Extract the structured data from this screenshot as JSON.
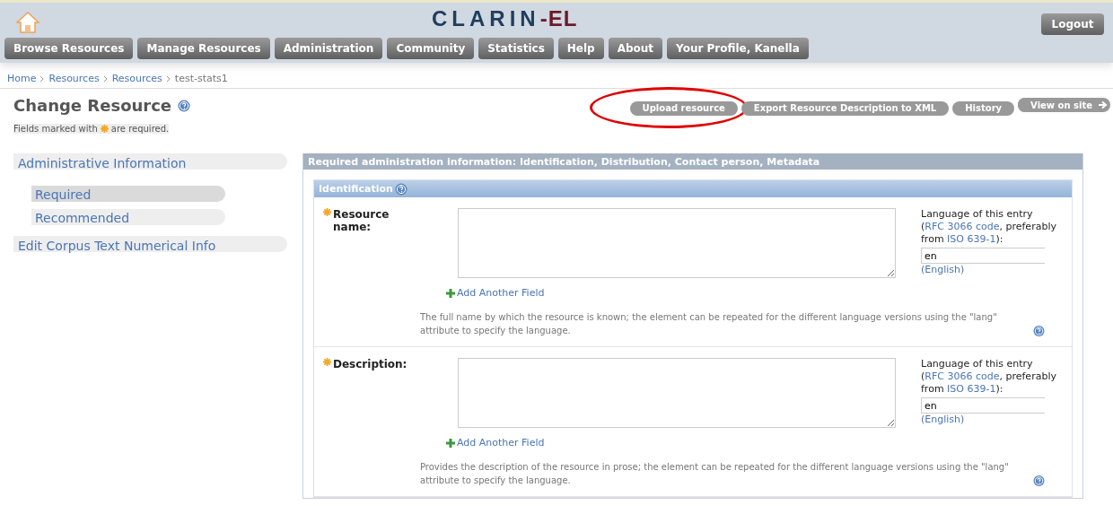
{
  "header": {
    "logo_main": "CLARIN",
    "logo_accent": "-EL",
    "logout": "Logout",
    "nav": [
      "Browse Resources",
      "Manage Resources",
      "Administration",
      "Community",
      "Statistics",
      "Help",
      "About",
      "Your Profile, Kanella"
    ]
  },
  "breadcrumb": {
    "links": [
      "Home",
      "Resources",
      "Resources"
    ],
    "current": "test-stats1"
  },
  "page": {
    "title": "Change Resource",
    "note_before": "Fields marked with",
    "note_after": "are required."
  },
  "actions": [
    {
      "label": "Upload resource",
      "highlighted": true
    },
    {
      "label": "Export Resource Description to XML",
      "highlighted": false
    },
    {
      "label": "History",
      "highlighted": false
    },
    {
      "label": "View on site",
      "highlighted": false
    }
  ],
  "sidebar": {
    "items": [
      {
        "label": "Administrative Information",
        "children": [
          {
            "label": "Required",
            "selected": true
          },
          {
            "label": "Recommended",
            "selected": false
          }
        ]
      },
      {
        "label": "Edit Corpus Text Numerical Info"
      }
    ]
  },
  "panel": {
    "title": "Required administration information: Identification, Distribution, Contact person, Metadata",
    "section": "Identification",
    "fields": [
      {
        "label": "Resource name:",
        "required": true,
        "lang_label": "Language of this entry (",
        "lang_link1": "RFC 3066 code",
        "lang_mid": ", preferably from",
        "lang_end": "):",
        "lang_link2": "ISO 639-1",
        "lang_value": "en",
        "lang_name": "(English)",
        "add": "Add Another Field",
        "help": "The full name by which the resource is known; the element can be repeated for the different language versions using the \"lang\" attribute to specify the language."
      },
      {
        "label": "Description:",
        "required": true,
        "lang_label": "Language of this entry (",
        "lang_link1": "RFC 3066 code",
        "lang_mid": ", preferably from",
        "lang_end": "):",
        "lang_link2": "ISO 639-1",
        "lang_value": "en",
        "lang_name": "(English)",
        "add": "Add Another Field",
        "help": "Provides the description of the resource in prose; the element can be repeated for the different language versions using the \"lang\" attribute to specify the language."
      }
    ]
  }
}
